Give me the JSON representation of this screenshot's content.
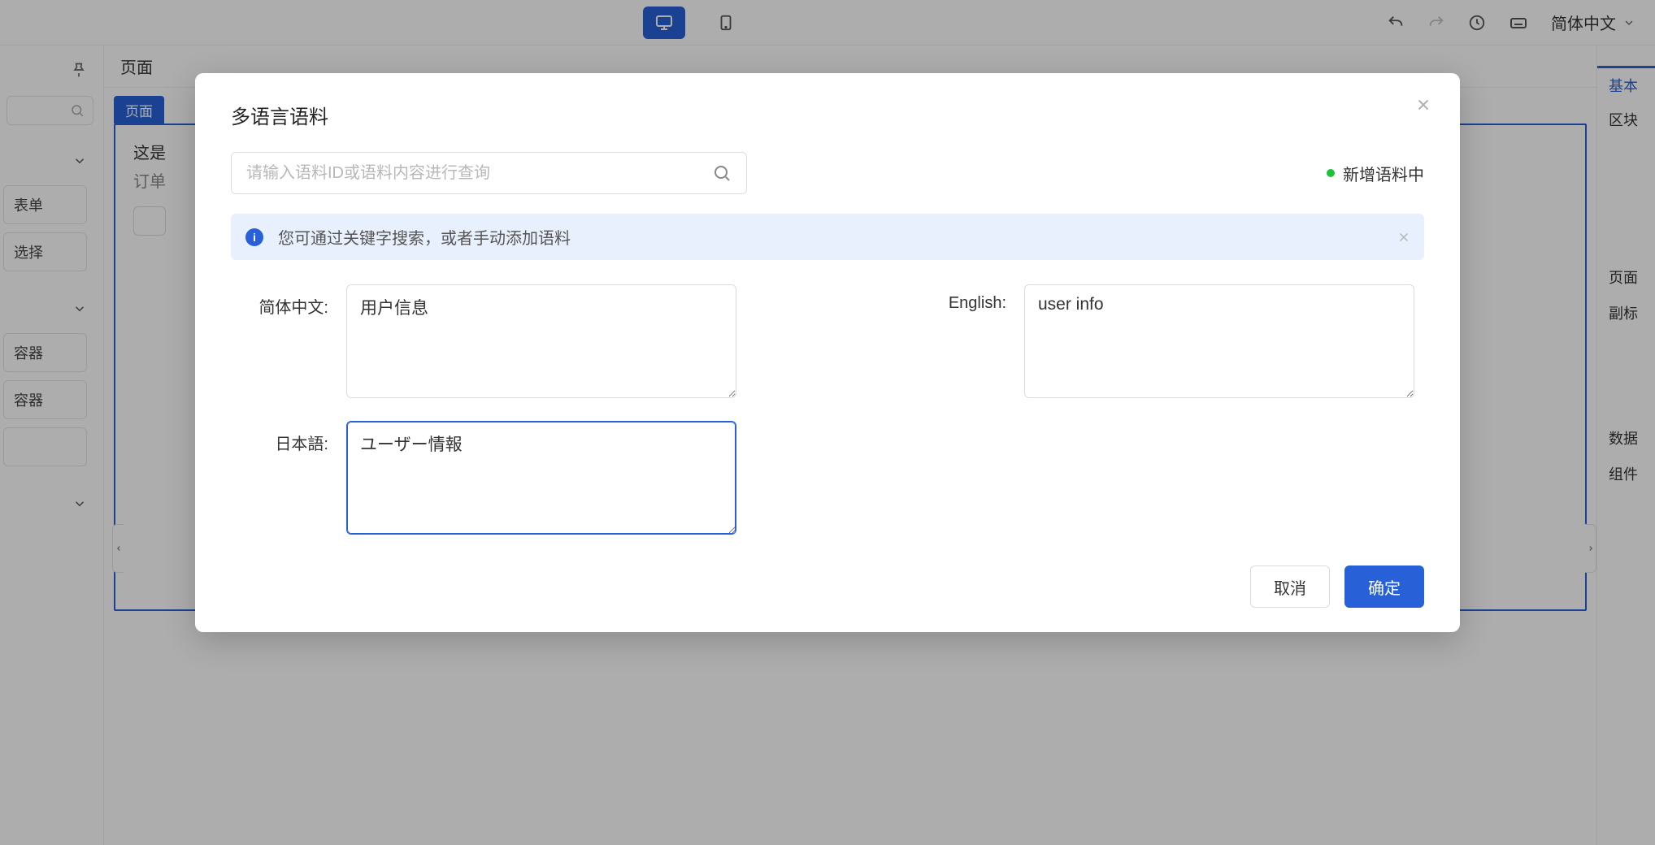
{
  "topbar": {
    "lang_label": "简体中文"
  },
  "left": {
    "items": [
      "表单",
      "选择",
      "容器",
      "容器"
    ]
  },
  "mid": {
    "crumb": "页面",
    "chip": "页面",
    "line1": "这是",
    "line2": "订单"
  },
  "right": {
    "tabs": [
      "基本",
      "区块",
      "页面",
      "副标",
      "数据",
      "组件"
    ]
  },
  "modal": {
    "title": "多语言语料",
    "search": {
      "placeholder": "请输入语料ID或语料内容进行查询"
    },
    "status": "新增语料中",
    "banner": "您可通过关键字搜索，或者手动添加语料",
    "fields": {
      "zh": {
        "label": "简体中文:",
        "value": "用户信息"
      },
      "en": {
        "label": "English:",
        "value": "user info"
      },
      "ja": {
        "label": "日本語:",
        "value": "ユーザー情報"
      }
    },
    "footer": {
      "cancel": "取消",
      "confirm": "确定"
    }
  }
}
